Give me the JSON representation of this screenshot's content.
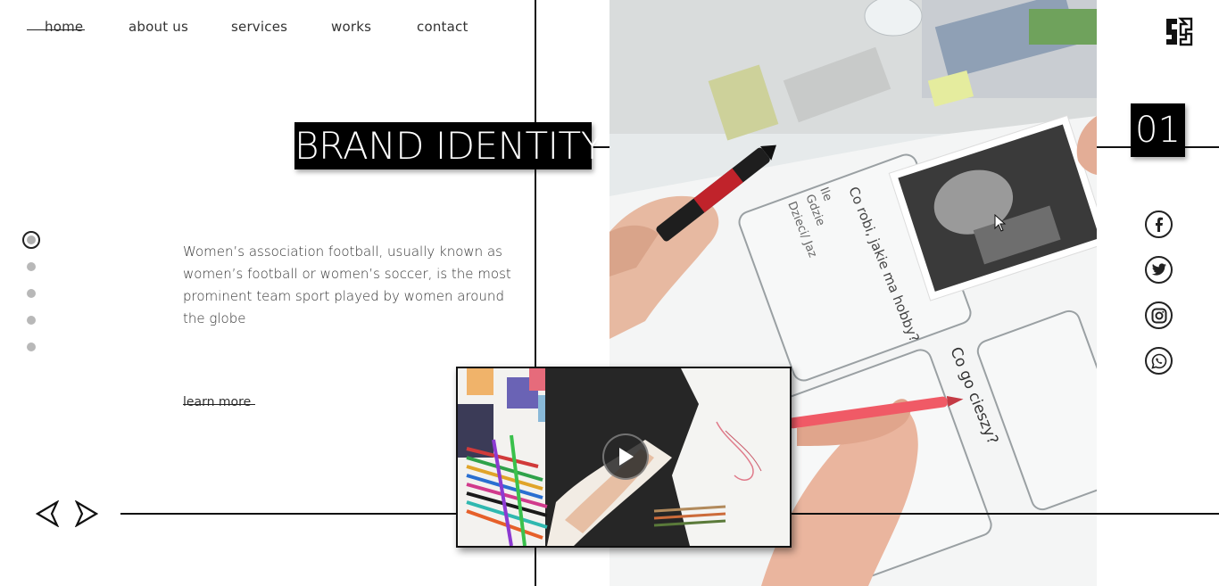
{
  "nav": {
    "items": [
      {
        "label": "home",
        "active": true
      },
      {
        "label": "about us"
      },
      {
        "label": "services"
      },
      {
        "label": "works"
      },
      {
        "label": "contact"
      }
    ]
  },
  "hero": {
    "title": "BRAND IDENTITY",
    "slide_number": "01",
    "description": "Women’s association football, usually known as women’s football or women’s soccer, is the most prominent team sport played by women around the globe",
    "learn_more": "learn more",
    "photo_notes": {
      "card_text_1": "Co robi, jakie ma hobby?",
      "card_text_2": "Co go cieszy?",
      "card_small_1": "Ile",
      "card_small_2": "Gdzie",
      "card_small_3": "Dzieci/ Jaz"
    }
  },
  "slides": {
    "count": 5,
    "active_index": 0
  },
  "social": [
    {
      "name": "facebook-icon"
    },
    {
      "name": "twitter-icon"
    },
    {
      "name": "instagram-icon"
    },
    {
      "name": "whatsapp-icon"
    }
  ],
  "colors": {
    "ink": "#111111",
    "dot_inactive": "#b8b8b8",
    "photo_bg": "#e9ecec"
  }
}
